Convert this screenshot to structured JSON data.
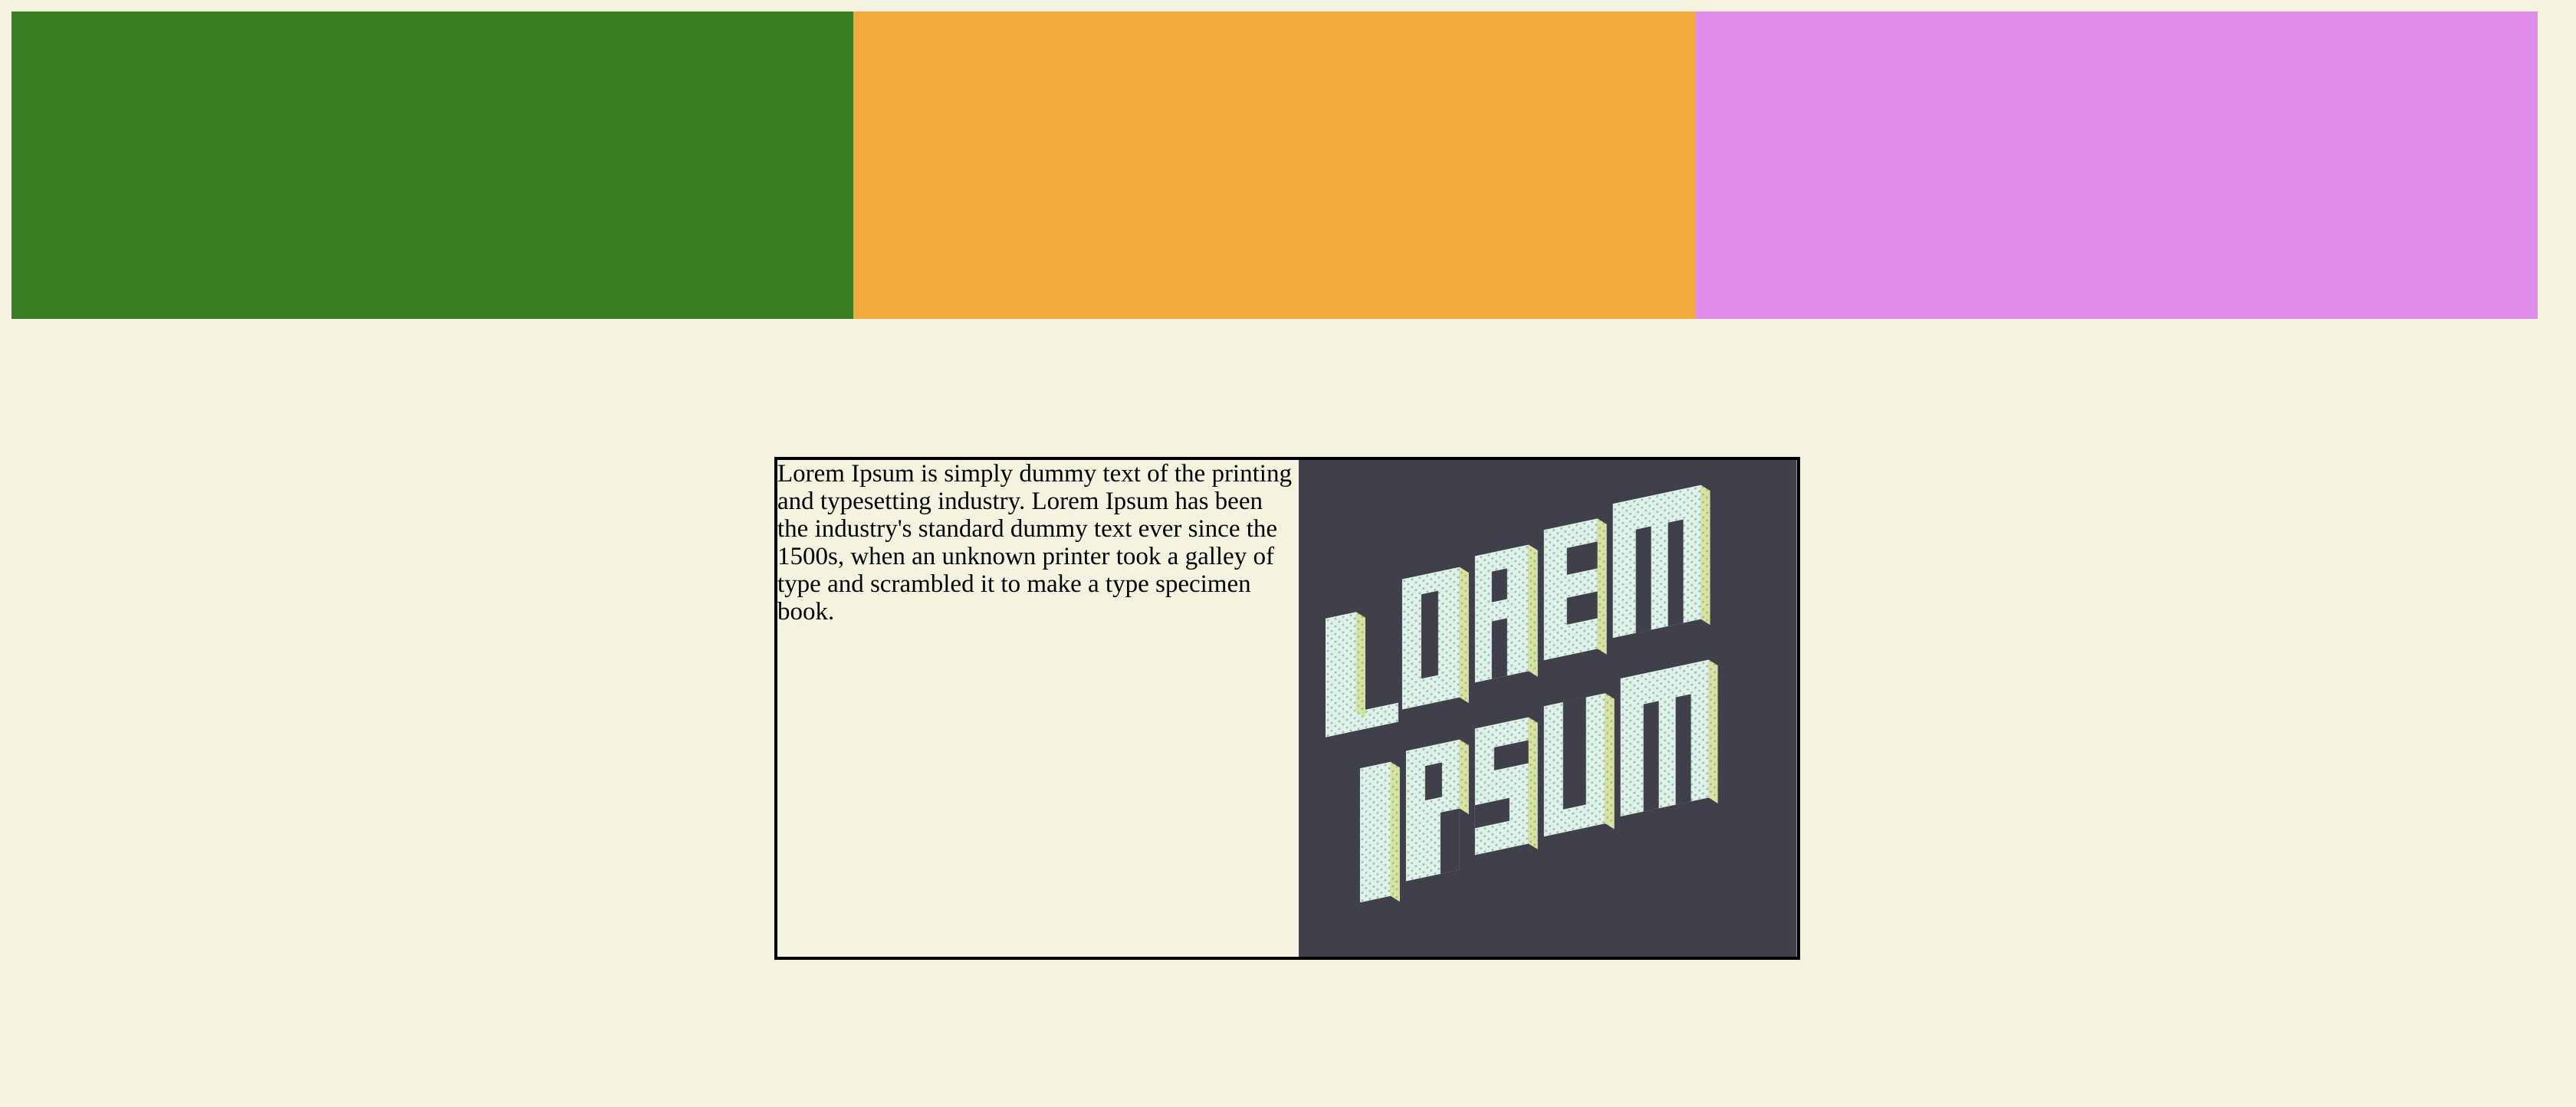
{
  "stripe": {
    "colors": [
      "#377d22",
      "#f4a93d",
      "#df8ce8"
    ]
  },
  "card": {
    "text": "Lorem Ipsum is simply dummy text of the printing and typesetting industry. Lorem Ipsum has been the industry's standard dummy text ever since the 1500s, when an unknown printer took a galley of type and scrambled it to make a type specimen book.",
    "image": {
      "background": "#3f4049",
      "lettering": [
        "LOREM",
        "IPSUM"
      ],
      "face_color": "#dff1e8",
      "side_color": "#d6e3a3"
    }
  }
}
